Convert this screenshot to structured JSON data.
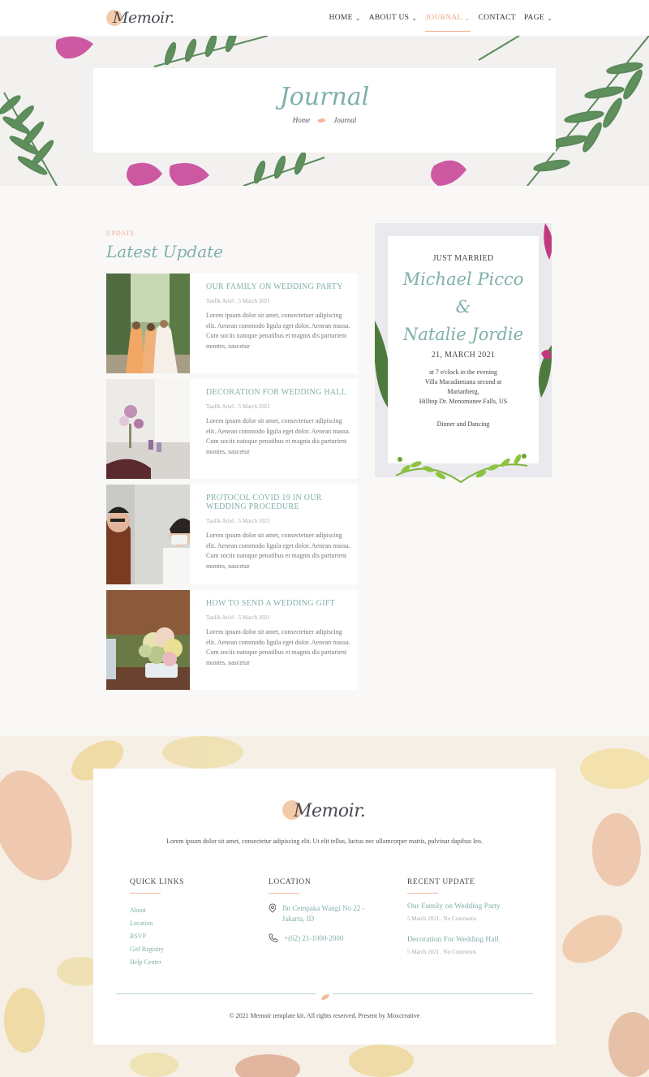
{
  "header": {
    "logo_text": "Memoir.",
    "nav": [
      {
        "label": "HOME"
      },
      {
        "label": "ABOUT US"
      },
      {
        "label": "JOURNAL"
      },
      {
        "label": "CONTACT"
      },
      {
        "label": "PAGE"
      }
    ],
    "active_color": "#f0a88a"
  },
  "hero": {
    "title": "Journal",
    "breadcrumb_home": "Home",
    "breadcrumb_current": "Journal"
  },
  "main": {
    "section_label": "UPDATE",
    "section_title": "Latest Update",
    "posts": [
      {
        "title": "OUR FAMILY ON WEDDING PARTY",
        "meta": "Taufik Arief . 5 March 2021",
        "excerpt": "Lorem ipsum dolor sit amet, consectetuer adipiscing elit. Aenean commodo ligula eget dolor. Aenean massa. Cum sociis natoque penatibus et magnis dis parturient montes, nascetur"
      },
      {
        "title": "DECORATION FOR WEDDING HALL",
        "meta": "Taufik Arief . 5 March 2021",
        "excerpt": "Lorem ipsum dolor sit amet, consectetuer adipiscing elit. Aenean commodo ligula eget dolor. Aenean massa. Cum sociis natoque penatibus et magnis dis parturient montes, nascetur"
      },
      {
        "title": "PROTOCOL COVID 19 IN OUR WEDDING PROCEDURE",
        "meta": "Taufik Arief . 5 March 2021",
        "excerpt": "Lorem ipsum dolor sit amet, consectetuer adipiscing elit. Aenean commodo ligula eget dolor. Aenean massa. Cum sociis natoque penatibus et magnis dis parturient montes, nascetur"
      },
      {
        "title": "HOW TO SEND A WEDDING GIFT",
        "meta": "Taufik Arief . 5 March 2021",
        "excerpt": "Lorem ipsum dolor sit amet, consectetuer adipiscing elit. Aenean commodo ligula eget dolor. Aenean massa. Cum sociis natoque penatibus et magnis dis parturient montes, nascetur"
      }
    ]
  },
  "invitation": {
    "heading": "JUST MARRIED",
    "name1": "Michael Picco",
    "ampersand": "&",
    "name2": "Natalie Jordie",
    "date": "21, MARCH 2021",
    "line1": "at 7 o'clock in the evening",
    "line2": "Villa Macadamiana second at",
    "line3": "Marianberg,",
    "line4": "Hilltop Dr. Menomonee Falls, US",
    "line5": "Dinner and Dancing"
  },
  "footer": {
    "logo_text": "Memoir.",
    "about": "Lorem ipsum dolor sit amet, consectetur adipiscing elit. Ut elit tellus, luctus nec ullamcorper mattis, pulvinar dapibus leo.",
    "quick_links_title": "QUICK LINKS",
    "quick_links": [
      "About",
      "Location",
      "RSVP",
      "Gitf Registry",
      "Help Center"
    ],
    "location_title": "LOCATION",
    "address": "Jln Cempaka Wangi No 22 - Jakarta, ID",
    "phone": "+(62) 21-1000-2000",
    "recent_title": "RECENT UPDATE",
    "recent": [
      {
        "title": "Our Family on Wedding Party",
        "meta": "5 March 2021 . No Comments"
      },
      {
        "title": "Decoration For Wedding Hall",
        "meta": "5 March 2021 . No Comments"
      }
    ],
    "copyright": "© 2021 Memoir template kit. All rights reserved. Present by Moxcreative"
  }
}
